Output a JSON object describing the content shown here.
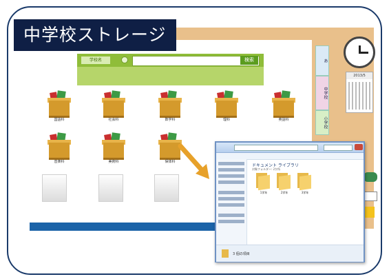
{
  "title": "中学校ストレージ",
  "search": {
    "tag_label": "学校名",
    "button_label": "検索"
  },
  "side_tabs": [
    "あ",
    "中学校",
    "小学校"
  ],
  "calendar": {
    "header": "2013/5"
  },
  "boxes": [
    {
      "label": "国語科"
    },
    {
      "label": "社会科"
    },
    {
      "label": "数学科"
    },
    {
      "label": "理科"
    },
    {
      "label": "英語科"
    },
    {
      "label": "音楽科"
    },
    {
      "label": "美術科"
    },
    {
      "label": "保体科"
    }
  ],
  "explorer": {
    "folder_title": "ドキュメント ライブラリ",
    "folder_sub": "対象フォルダー: 2か所",
    "folders": [
      {
        "label": "1学年"
      },
      {
        "label": "2学年"
      },
      {
        "label": "3学年"
      }
    ],
    "status_text": "3 個の項目"
  },
  "colors": {
    "banner": "#0f1f45",
    "accent_green": "#8fbd39",
    "wood": "#e9c08b",
    "blue_bar": "#1b63a8"
  }
}
